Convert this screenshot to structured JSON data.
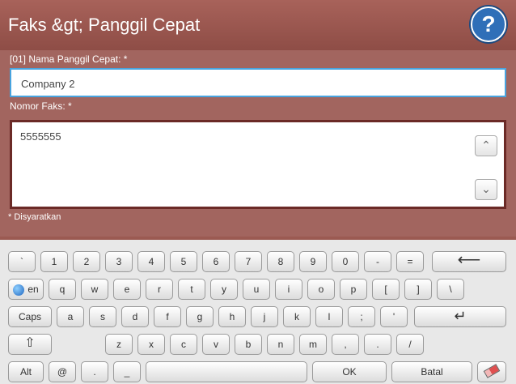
{
  "header": {
    "title": "Faks &gt; Panggil Cepat",
    "help_icon": "question-circle-icon"
  },
  "form": {
    "speed_dial_name_label": "[01] Nama Panggil Cepat: *",
    "speed_dial_name_value": "Company 2",
    "fax_number_label": "Nomor Faks: *",
    "fax_number_value": "5555555",
    "required_note": "* Disyaratkan"
  },
  "keyboard": {
    "row1": [
      "`",
      "1",
      "2",
      "3",
      "4",
      "5",
      "6",
      "7",
      "8",
      "9",
      "0",
      "-",
      "="
    ],
    "row2": [
      "en",
      "q",
      "w",
      "e",
      "r",
      "t",
      "y",
      "u",
      "i",
      "o",
      "p",
      "[",
      "]",
      "\\"
    ],
    "row3": [
      "Caps",
      "a",
      "s",
      "d",
      "f",
      "g",
      "h",
      "j",
      "k",
      "l",
      ";",
      "'"
    ],
    "row4": [
      "z",
      "x",
      "c",
      "v",
      "b",
      "n",
      "m",
      ",",
      ".",
      "/"
    ],
    "row5": [
      "Alt",
      "@",
      ".",
      "_",
      "OK",
      "Batal"
    ]
  }
}
